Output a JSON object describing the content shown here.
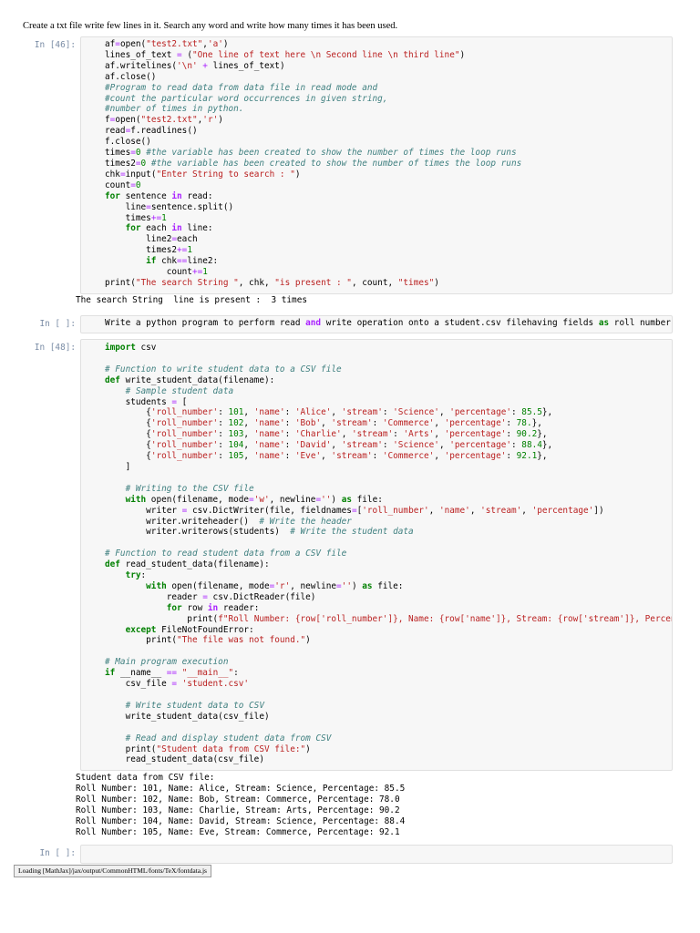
{
  "instructions": "Create a txt file write few lines in it. Search any word and write how many times it has been used.",
  "cells": [
    {
      "prompt": "In [46]:",
      "code": "af=open(\"test2.txt\",'a')\nlines_of_text = (\"One line of text here \\n Second line \\n third line\")\naf.writelines('\\n' + lines_of_text)\naf.close()\n#Program to read data from data file in read mode and\n#count the particular word occurrences in given string,\n#number of times in python.\nf=open(\"test2.txt\",'r')\nread=f.readlines()\nf.close()\ntimes=0 #the variable has been created to show the number of times the loop runs\ntimes2=0 #the variable has been created to show the number of times the loop runs\nchk=input(\"Enter String to search : \")\ncount=0\nfor sentence in read:\n    line=sentence.split()\n    times+=1\n    for each in line:\n        line2=each\n        times2+=1\n        if chk==line2:\n            count+=1\nprint(\"The search String \", chk, \"is present : \", count, \"times\")",
      "output": "The search String  line is present :  3 times"
    },
    {
      "prompt": "In [ ]:",
      "code": "Write a python program to perform read and write operation onto a student.csv filehaving fields as roll number, name, stream and perce",
      "output": ""
    },
    {
      "prompt": "In [48]:",
      "code": "import csv\n\n# Function to write student data to a CSV file\ndef write_student_data(filename):\n    # Sample student data\n    students = [\n        {'roll_number': 101, 'name': 'Alice', 'stream': 'Science', 'percentage': 85.5},\n        {'roll_number': 102, 'name': 'Bob', 'stream': 'Commerce', 'percentage': 78.},\n        {'roll_number': 103, 'name': 'Charlie', 'stream': 'Arts', 'percentage': 90.2},\n        {'roll_number': 104, 'name': 'David', 'stream': 'Science', 'percentage': 88.4},\n        {'roll_number': 105, 'name': 'Eve', 'stream': 'Commerce', 'percentage': 92.1},\n    ]\n\n    # Writing to the CSV file\n    with open(filename, mode='w', newline='') as file:\n        writer = csv.DictWriter(file, fieldnames=['roll_number', 'name', 'stream', 'percentage'])\n        writer.writeheader()  # Write the header\n        writer.writerows(students)  # Write the student data\n\n# Function to read student data from a CSV file\ndef read_student_data(filename):\n    try:\n        with open(filename, mode='r', newline='') as file:\n            reader = csv.DictReader(file)\n            for row in reader:\n                print(f\"Roll Number: {row['roll_number']}, Name: {row['name']}, Stream: {row['stream']}, Percentage: {row['percentage']}\")\n    except FileNotFoundError:\n        print(\"The file was not found.\")\n\n# Main program execution\nif __name__ == \"__main__\":\n    csv_file = 'student.csv'\n\n    # Write student data to CSV\n    write_student_data(csv_file)\n\n    # Read and display student data from CSV\n    print(\"Student data from CSV file:\")\n    read_student_data(csv_file)",
      "output": "Student data from CSV file:\nRoll Number: 101, Name: Alice, Stream: Science, Percentage: 85.5\nRoll Number: 102, Name: Bob, Stream: Commerce, Percentage: 78.0\nRoll Number: 103, Name: Charlie, Stream: Arts, Percentage: 90.2\nRoll Number: 104, Name: David, Stream: Science, Percentage: 88.4\nRoll Number: 105, Name: Eve, Stream: Commerce, Percentage: 92.1"
    },
    {
      "prompt": "In [ ]:",
      "code": "",
      "output": ""
    }
  ],
  "status_text": "Loading [MathJax]/jax/output/CommonHTML/fonts/TeX/fontdata.js",
  "colors": {
    "keyword": "#008000",
    "string": "#ba2121",
    "operator": "#aa22ff",
    "comment": "#408080",
    "prompt": "#7a8ca5",
    "cell_background": "#f7f7f7"
  }
}
